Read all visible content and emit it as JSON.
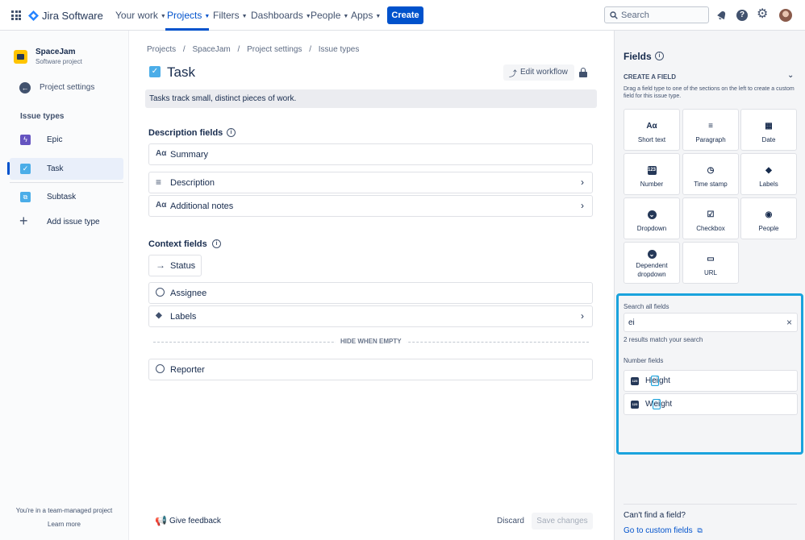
{
  "topbar": {
    "app_name": "Jira Software",
    "nav": [
      "Your work",
      "Projects",
      "Filters",
      "Dashboards",
      "People",
      "Apps"
    ],
    "create_label": "Create",
    "search_placeholder": "Search"
  },
  "sidebar": {
    "project_name": "SpaceJam",
    "project_type": "Software project",
    "settings_label": "Project settings",
    "section_title": "Issue types",
    "items": [
      {
        "label": "Epic",
        "color": "#6554c0"
      },
      {
        "label": "Task",
        "color": "#4bade8"
      },
      {
        "label": "Subtask",
        "color": "#4bade8"
      }
    ],
    "add_label": "Add issue type",
    "footer_text": "You're in a team-managed project",
    "learn_more": "Learn more"
  },
  "main": {
    "breadcrumb": [
      "Projects",
      "/",
      "SpaceJam",
      "/",
      "Project settings",
      "/",
      "Issue types"
    ],
    "title": "Task",
    "edit_workflow": "Edit workflow",
    "description": "Tasks track small, distinct pieces of work.",
    "description_fields_title": "Description fields",
    "description_fields": [
      {
        "label": "Summary",
        "icon": "text-icon",
        "has_arrow": false
      },
      {
        "label": "Description",
        "icon": "paragraph-icon",
        "has_arrow": true
      },
      {
        "label": "Additional notes",
        "icon": "text-icon",
        "has_arrow": true
      }
    ],
    "context_fields_title": "Context fields",
    "status_label": "Status",
    "context_fields": [
      {
        "label": "Assignee",
        "icon": "person-icon",
        "has_arrow": false
      },
      {
        "label": "Labels",
        "icon": "label-icon",
        "has_arrow": true
      }
    ],
    "hide_when_empty": "HIDE WHEN EMPTY",
    "hidden_fields": [
      {
        "label": "Reporter",
        "icon": "person-icon"
      }
    ],
    "feedback": "Give feedback",
    "discard": "Discard",
    "save": "Save changes"
  },
  "right_panel": {
    "title": "Fields",
    "create_title": "CREATE A FIELD",
    "create_desc": "Drag a field type to one of the sections on the left to create a custom field for this issue type.",
    "field_types": [
      {
        "label": "Short text",
        "icon": "text-icon",
        "glyph": "Aα"
      },
      {
        "label": "Paragraph",
        "icon": "paragraph-icon",
        "glyph": "≡"
      },
      {
        "label": "Date",
        "icon": "calendar-icon",
        "glyph": "▦"
      },
      {
        "label": "Number",
        "icon": "number-icon",
        "glyph": "123"
      },
      {
        "label": "Time stamp",
        "icon": "clock-icon",
        "glyph": "◷"
      },
      {
        "label": "Labels",
        "icon": "label-icon",
        "glyph": "◆"
      },
      {
        "label": "Dropdown",
        "icon": "dropdown-icon",
        "glyph": "⌄"
      },
      {
        "label": "Checkbox",
        "icon": "checkbox-icon",
        "glyph": "☑"
      },
      {
        "label": "People",
        "icon": "person-icon",
        "glyph": "◉"
      },
      {
        "label": "Dependent\ndropdown",
        "icon": "dependent-dropdown-icon",
        "glyph": "⌄"
      },
      {
        "label": "URL",
        "icon": "url-icon",
        "glyph": "▭"
      }
    ],
    "search_label": "Search all fields",
    "search_value": "ei",
    "results_text": "2 results match your search",
    "results_group": "Number fields",
    "results": [
      {
        "pre": "H",
        "match": "ei",
        "post": "ght"
      },
      {
        "pre": "W",
        "match": "ei",
        "post": "ght"
      }
    ],
    "cant_find": "Can't find a field?",
    "custom_fields_link": "Go to custom fields",
    "highlight_color": "#1aa3dd"
  }
}
